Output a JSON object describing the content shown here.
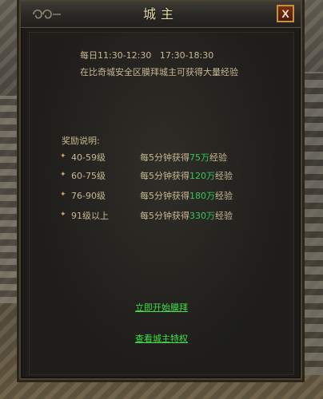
{
  "dialog": {
    "title": "城主",
    "close_label": "X"
  },
  "schedule": {
    "label": "每日",
    "time1": "11:30-12:30",
    "time2": "17:30-18:30",
    "description": "在比奇城安全区膜拜城主可获得大量经验"
  },
  "rewards": {
    "title": "奖励说明:",
    "rate_prefix": "每5分钟获得",
    "rate_suffix": "经验",
    "rows": [
      {
        "level": "40-59级",
        "amount": "75万"
      },
      {
        "level": "60-75级",
        "amount": "120万"
      },
      {
        "level": "76-90级",
        "amount": "180万"
      },
      {
        "level": "91级以上",
        "amount": "330万"
      }
    ]
  },
  "actions": {
    "worship_label": "立即开始膜拜",
    "privilege_label": "查看城主特权"
  },
  "colors": {
    "highlight_green": "#36c95a",
    "link_green": "#3fe046",
    "text_tan": "#c9b893",
    "title_gold": "#e9dca6"
  }
}
